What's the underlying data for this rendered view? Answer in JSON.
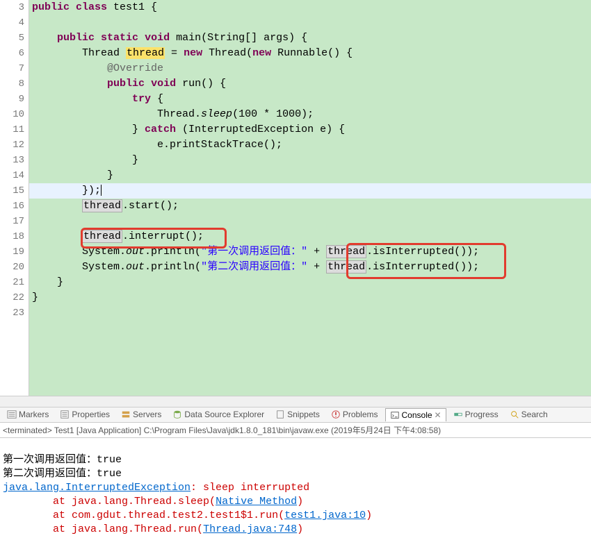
{
  "gutter": [
    "3",
    "4",
    "5",
    "6",
    "7",
    "8",
    "9",
    "10",
    "11",
    "12",
    "13",
    "14",
    "15",
    "16",
    "17",
    "18",
    "19",
    "20",
    "21",
    "22",
    "23"
  ],
  "code": {
    "l3": {
      "pre": "",
      "k1": "public",
      "s1": " ",
      "k2": "class",
      "s2": " test1 {"
    },
    "l4": "",
    "l5": {
      "pre": "    ",
      "k1": "public",
      "s1": " ",
      "k2": "static",
      "s2": " ",
      "k3": "void",
      "s3": " main(String[] args) {"
    },
    "l6": {
      "pre": "        Thread ",
      "hw": "thread",
      "mid": " = ",
      "k1": "new",
      "s1": " Thread(",
      "k2": "new",
      "s2": " Runnable() {"
    },
    "l7": {
      "pre": "            ",
      "ann": "@Override"
    },
    "l8": {
      "pre": "            ",
      "k1": "public",
      "s1": " ",
      "k2": "void",
      "s2": " run() {"
    },
    "l9": {
      "pre": "                ",
      "k1": "try",
      "s1": " {"
    },
    "l10": {
      "pre": "                    Thread.",
      "m": "sleep",
      "post": "(100 * 1000);"
    },
    "l11": {
      "pre": "                } ",
      "k1": "catch",
      "s1": " (InterruptedException e) {"
    },
    "l12": "                    e.printStackTrace();",
    "l13": "                }",
    "l14": "            }",
    "l15": "        });",
    "l16": {
      "pre": "        ",
      "hw": "thread",
      "post": ".start();"
    },
    "l17": "",
    "l18": {
      "pre": "        ",
      "hw": "thread",
      "post": ".interrupt();"
    },
    "l19": {
      "pre": "        System.",
      "m": "out",
      "post1": ".println(",
      "str": "\"第一次调用返回值：\"",
      "mid": " + ",
      "hw": "thread",
      "post2": ".isInterrupted());"
    },
    "l20": {
      "pre": "        System.",
      "m": "out",
      "post1": ".println(",
      "str": "\"第二次调用返回值：\"",
      "mid": " + ",
      "hw": "thread",
      "post2": ".isInterrupted());"
    },
    "l21": "    }",
    "l22": "}",
    "l23": ""
  },
  "tabs": {
    "markers": "Markers",
    "properties": "Properties",
    "servers": "Servers",
    "dse": "Data Source Explorer",
    "snippets": "Snippets",
    "problems": "Problems",
    "console": "Console",
    "progress": "Progress",
    "search": "Search"
  },
  "termline": "<terminated> Test1 [Java Application] C:\\Program Files\\Java\\jdk1.8.0_181\\bin\\javaw.exe (2019年5月24日 下午4:08:58)",
  "console": {
    "l1": "第一次调用返回值：true",
    "l2": "第二次调用返回值：true",
    "l3a": "java.lang.InterruptedException",
    "l3b": ": sleep interrupted",
    "l4a": "\tat java.lang.Thread.sleep(",
    "l4b": "Native Method",
    "l4c": ")",
    "l5a": "\tat com.gdut.thread.test2.test1$1.run(",
    "l5b": "test1.java:10",
    "l5c": ")",
    "l6a": "\tat java.lang.Thread.run(",
    "l6b": "Thread.java:748",
    "l6c": ")"
  }
}
